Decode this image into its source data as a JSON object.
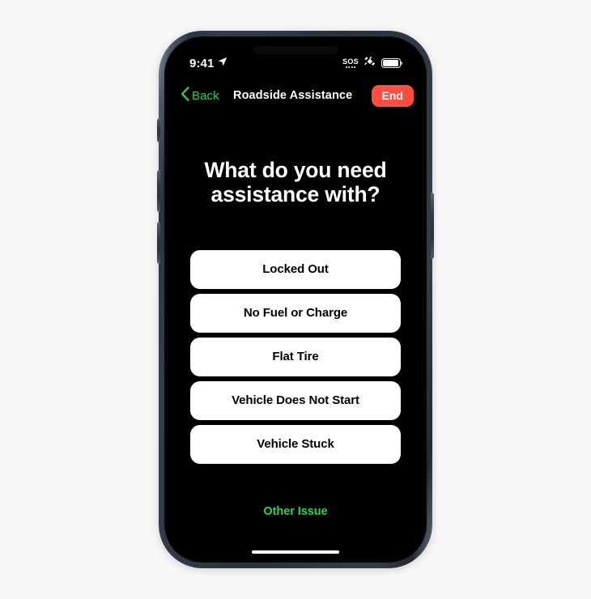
{
  "page": {
    "background_color": "#f7f7f7"
  },
  "device": {
    "frame_color": "#2b3240",
    "screen_background": "#000000",
    "buttons": {
      "action_button": "action-button",
      "volume_up": "volume-up-button",
      "volume_down": "volume-down-button",
      "power": "power-button"
    }
  },
  "status_bar": {
    "time": "9:41",
    "location_icon": "location-arrow-icon",
    "sos_label": "SOS",
    "satellite_icon": "satellite-icon",
    "battery_icon": "battery-full-icon",
    "battery_level": 100
  },
  "nav_bar": {
    "back_label": "Back",
    "back_icon": "chevron-left-icon",
    "title": "Roadside Assistance",
    "end_label": "End",
    "accent_color": "#30d158",
    "end_button_color": "#ff4d41"
  },
  "main": {
    "headline_line_1": "What do you need",
    "headline_line_2": "assistance with?",
    "options": [
      {
        "label": "Locked Out"
      },
      {
        "label": "No Fuel or Charge"
      },
      {
        "label": "Flat Tire"
      },
      {
        "label": "Vehicle Does Not Start"
      },
      {
        "label": "Vehicle Stuck"
      }
    ],
    "other_issue_label": "Other Issue"
  },
  "home_indicator": {
    "name": "home-indicator"
  }
}
